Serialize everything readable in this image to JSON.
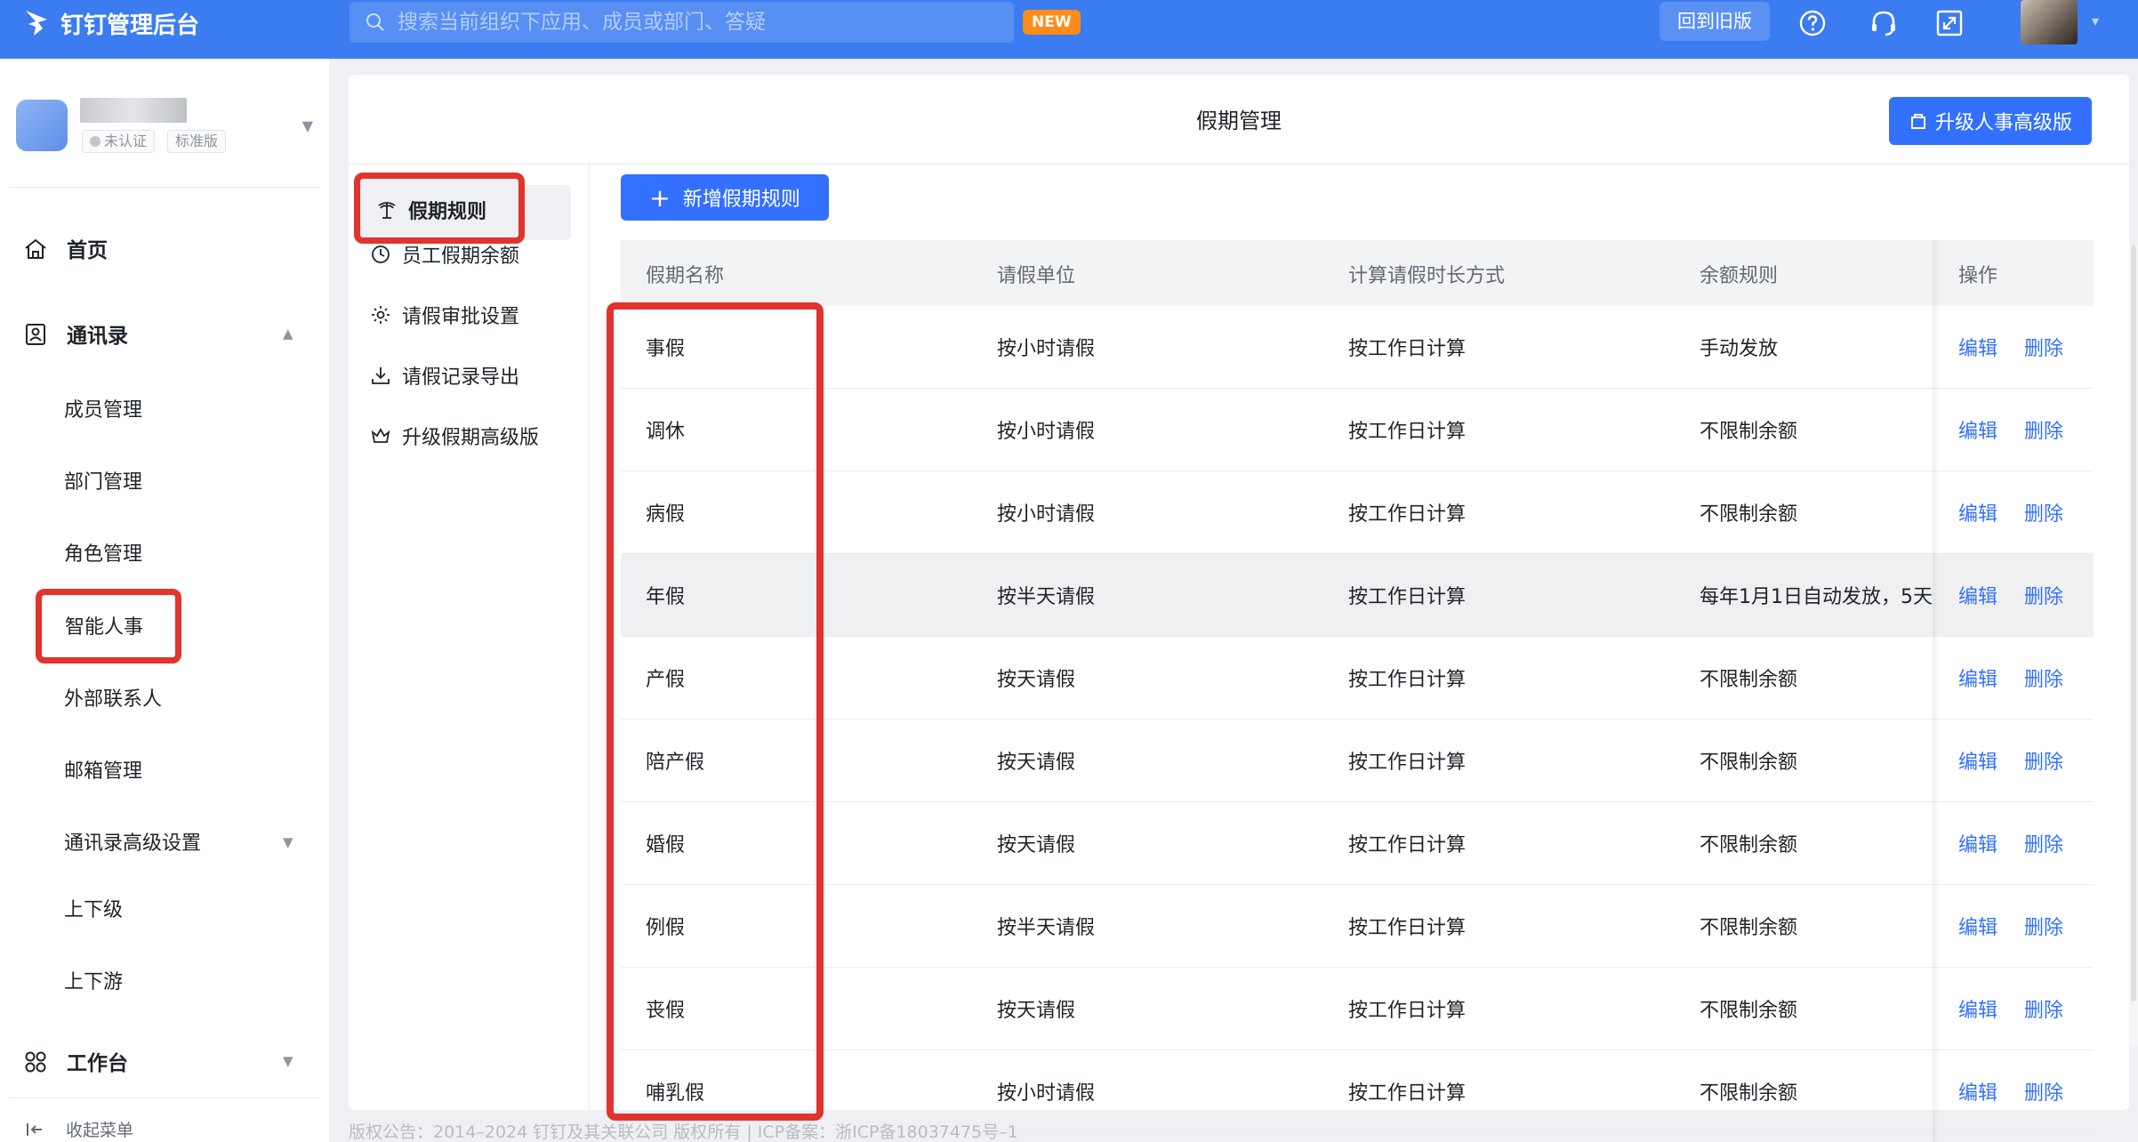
{
  "topbar": {
    "title": "钉钉管理后台",
    "search_placeholder": "搜索当前组织下应用、成员或部门、答疑",
    "new_badge": "NEW",
    "old_version": "回到旧版",
    "icons": [
      "help-icon",
      "headset-icon",
      "fullscreen-icon"
    ]
  },
  "org": {
    "tags": [
      "未认证",
      "标准版"
    ]
  },
  "sidebar": {
    "home": "首页",
    "contacts": "通讯录",
    "sub_items": [
      "成员管理",
      "部门管理",
      "角色管理",
      "智能人事",
      "外部联系人",
      "邮箱管理",
      "通讯录高级设置",
      "上下级",
      "上下游"
    ],
    "workbench": "工作台",
    "collapse": "收起菜单",
    "selected": "智能人事"
  },
  "main": {
    "page_title": "假期管理",
    "upgrade_button": "升级人事高级版",
    "add_button": "新增假期规则",
    "inner_nav": [
      {
        "label": "假期规则",
        "icon": "palm-tree-icon",
        "active": true
      },
      {
        "label": "员工假期余额",
        "icon": "clock-icon",
        "active": false
      },
      {
        "label": "请假审批设置",
        "icon": "gear-icon",
        "active": false
      },
      {
        "label": "请假记录导出",
        "icon": "download-icon",
        "active": false
      },
      {
        "label": "升级假期高级版",
        "icon": "crown-icon",
        "active": false
      }
    ]
  },
  "table": {
    "headers": [
      "假期名称",
      "请假单位",
      "计算请假时长方式",
      "余额规则",
      "操作"
    ],
    "edit_label": "编辑",
    "delete_label": "删除",
    "rows": [
      {
        "name": "事假",
        "unit": "按小时请假",
        "method": "按工作日计算",
        "balance": "手动发放"
      },
      {
        "name": "调休",
        "unit": "按小时请假",
        "method": "按工作日计算",
        "balance": "不限制余额"
      },
      {
        "name": "病假",
        "unit": "按小时请假",
        "method": "按工作日计算",
        "balance": "不限制余额"
      },
      {
        "name": "年假",
        "unit": "按半天请假",
        "method": "按工作日计算",
        "balance": "每年1月1日自动发放，5天"
      },
      {
        "name": "产假",
        "unit": "按天请假",
        "method": "按工作日计算",
        "balance": "不限制余额"
      },
      {
        "name": "陪产假",
        "unit": "按天请假",
        "method": "按工作日计算",
        "balance": "不限制余额"
      },
      {
        "name": "婚假",
        "unit": "按天请假",
        "method": "按工作日计算",
        "balance": "不限制余额"
      },
      {
        "name": "例假",
        "unit": "按半天请假",
        "method": "按工作日计算",
        "balance": "不限制余额"
      },
      {
        "name": "丧假",
        "unit": "按天请假",
        "method": "按工作日计算",
        "balance": "不限制余额"
      },
      {
        "name": "哺乳假",
        "unit": "按小时请假",
        "method": "按工作日计算",
        "balance": "不限制余额"
      }
    ]
  },
  "footer": "版权公告：2014–2024 钉钉及其关联公司 版权所有 | ICP备案：浙ICP备18037475号–1",
  "colors": {
    "topbar": "#3b7cf0",
    "primary": "#3370ff",
    "highlight_box": "#e0342c"
  }
}
